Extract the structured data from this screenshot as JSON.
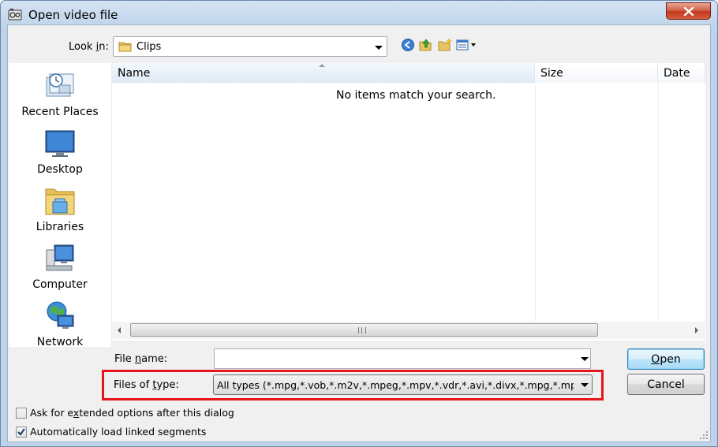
{
  "window": {
    "title": "Open video file",
    "close_label": "Close"
  },
  "lookin": {
    "label_prefix": "Look ",
    "label_accel": "i",
    "label_suffix": "n:",
    "value": "Clips"
  },
  "toolbar": {
    "icons": [
      "back-icon",
      "up-folder-icon",
      "new-folder-icon",
      "view-menu-icon"
    ]
  },
  "places": [
    {
      "label": "Recent Places",
      "icon": "recent-places-icon"
    },
    {
      "label": "Desktop",
      "icon": "desktop-icon"
    },
    {
      "label": "Libraries",
      "icon": "libraries-icon"
    },
    {
      "label": "Computer",
      "icon": "computer-icon"
    },
    {
      "label": "Network",
      "icon": "network-icon"
    }
  ],
  "list": {
    "columns": [
      "Name",
      "Size",
      "Date"
    ],
    "empty_message": "No items match your search."
  },
  "filename": {
    "label_prefix": "File ",
    "label_accel": "n",
    "label_suffix": "ame:",
    "value": ""
  },
  "filetype": {
    "label_prefix": "Files of ",
    "label_accel": "t",
    "label_suffix": "ype:",
    "value": "All types (*.mpg,*.vob,*.m2v,*.mpeg,*.mpv,*.vdr,*.avi,*.divx,*.mpg,*.mpeg,*.mp"
  },
  "buttons": {
    "open_accel": "O",
    "open_rest": "pen",
    "cancel": "Cancel"
  },
  "options": {
    "ask_extended_prefix": "Ask for e",
    "ask_extended_accel": "x",
    "ask_extended_suffix": "tended options after this dialog",
    "ask_extended_checked": false,
    "auto_load": "Automatically load linked segments",
    "auto_load_checked": true
  },
  "colors": {
    "highlight": "#e8141c",
    "close_button": "#c23a1f"
  }
}
